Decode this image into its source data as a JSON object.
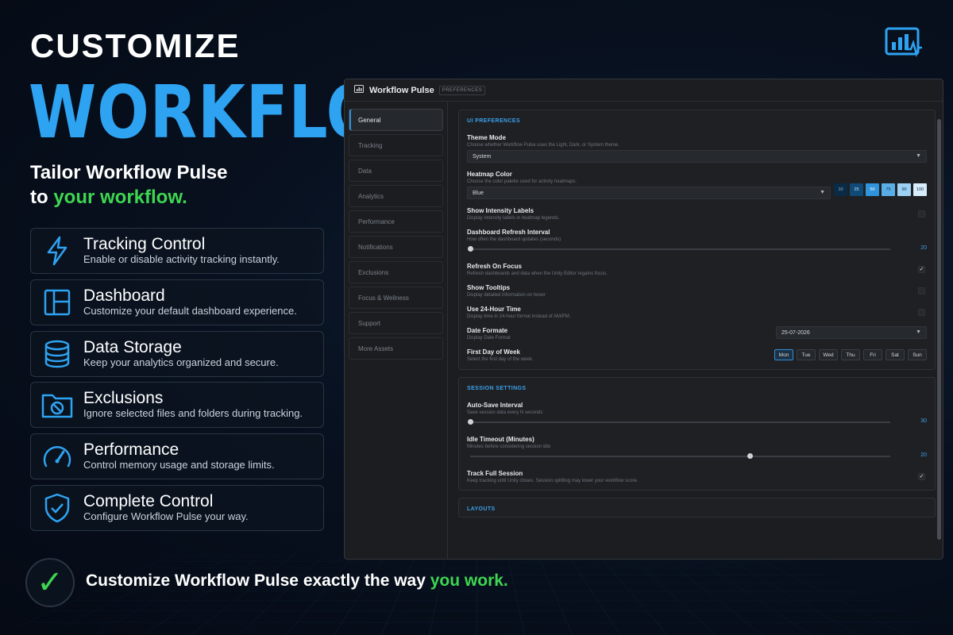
{
  "hero": {
    "line1": "CUSTOMIZE",
    "line2": "WORKFLOW",
    "tagline_line1": "Tailor Workflow Pulse",
    "tagline_prefix": "to ",
    "tagline_accent": "your workflow."
  },
  "features": [
    {
      "title": "Tracking Control",
      "desc": "Enable or disable activity tracking instantly.",
      "icon": "lightning-icon"
    },
    {
      "title": "Dashboard",
      "desc": "Customize your default dashboard experience.",
      "icon": "dashboard-layout-icon"
    },
    {
      "title": "Data Storage",
      "desc": "Keep your analytics organized and secure.",
      "icon": "database-icon"
    },
    {
      "title": "Exclusions",
      "desc": "Ignore selected files and folders during tracking.",
      "icon": "folder-blocked-icon"
    },
    {
      "title": "Performance",
      "desc": "Control memory usage and storage limits.",
      "icon": "gauge-icon"
    },
    {
      "title": "Complete Control",
      "desc": "Configure Workflow Pulse your way.",
      "icon": "shield-check-icon"
    }
  ],
  "footer": {
    "text": "Customize Workflow Pulse exactly the way ",
    "accent": "you work."
  },
  "window": {
    "title": "Workflow Pulse",
    "badge": "PREFERENCES"
  },
  "nav": [
    "General",
    "Tracking",
    "Data",
    "Analytics",
    "Performance",
    "Notifications",
    "Exclusions",
    "Focus & Wellness",
    "Support",
    "More Assets"
  ],
  "ui_prefs": {
    "header": "UI PREFERENCES",
    "theme_title": "Theme Mode",
    "theme_desc": "Choose whether Workflow Pulse uses the Light, Dark, or System theme.",
    "theme_value": "System",
    "heatmap_title": "Heatmap Color",
    "heatmap_desc": "Choose the color palette used for activity heatmaps.",
    "heatmap_value": "Blue",
    "swatches": [
      "10",
      "25",
      "50",
      "75",
      "90",
      "100"
    ],
    "intensity_title": "Show Intensity Labels",
    "intensity_desc": "Display intensity labels in heatmap legends.",
    "refresh_title": "Dashboard Refresh Interval",
    "refresh_desc": "How often the dashboard updates (seconds)",
    "refresh_value": "20",
    "focus_title": "Refresh On Focus",
    "focus_desc": "Refresh dashboards and data when the Unity Editor regains focus.",
    "tooltips_title": "Show Tooltips",
    "tooltips_desc": "Display detailed information on hover",
    "time_title": "Use 24-Hour Time",
    "time_desc": "Display time in 24-hour format instead of AM/PM.",
    "date_title": "Date Formate",
    "date_desc": "Display Date Format",
    "date_value": "25-07-2026",
    "week_title": "First Day of Week",
    "week_desc": "Select the first day of the week.",
    "days": [
      "Mon",
      "Tue",
      "Wed",
      "Thu",
      "Fri",
      "Sat",
      "Sun"
    ]
  },
  "session": {
    "header": "SESSION SETTINGS",
    "autosave_title": "Auto-Save Interval",
    "autosave_desc": "Save session data every N seconds",
    "autosave_value": "30",
    "idle_title": "Idle Timeout (Minutes)",
    "idle_desc": "Minutes before considering session idle",
    "idle_value": "20",
    "full_title": "Track Full Session",
    "full_desc": "Keep tracking until Unity closes. Session splitting may lower your workflow score."
  },
  "layouts": {
    "header": "LAYOUTS"
  },
  "checkmark": "✓",
  "colors": {
    "accent_blue": "#2ea3f2",
    "accent_green": "#3ed651",
    "panel_bg": "#1b1d21"
  }
}
